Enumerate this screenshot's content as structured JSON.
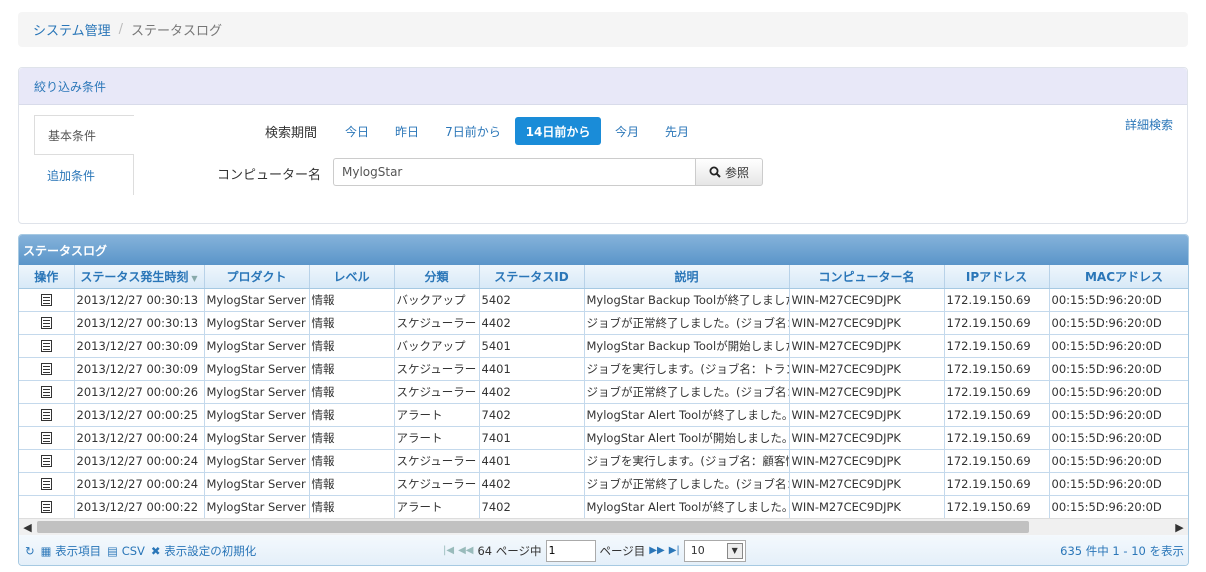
{
  "breadcrumb": {
    "parent": "システム管理",
    "separator": "/",
    "current": "ステータスログ"
  },
  "filter": {
    "header": "絞り込み条件",
    "tabs": [
      "基本条件",
      "追加条件"
    ],
    "period_label": "検索期間",
    "periods": [
      "今日",
      "昨日",
      "7日前から",
      "14日前から",
      "今月",
      "先月"
    ],
    "active_period": "14日前から",
    "detail_search": "詳細検索",
    "computer_label": "コンピューター名",
    "computer_value": "MylogStar",
    "search_button": "参照"
  },
  "grid": {
    "title": "ステータスログ",
    "columns": [
      "操作",
      "ステータス発生時刻",
      "プロダクト",
      "レベル",
      "分類",
      "ステータスID",
      "説明",
      "コンピューター名",
      "IPアドレス",
      "MACアドレス"
    ],
    "rows": [
      [
        "2013/12/27 00:30:13",
        "MylogStar Server",
        "情報",
        "バックアップ",
        "5402",
        "MylogStar Backup Toolが終了しました。",
        "WIN-M27CEC9DJPK",
        "172.19.150.69",
        "00:15:5D:96:20:0D"
      ],
      [
        "2013/12/27 00:30:13",
        "MylogStar Server",
        "情報",
        "スケジューラー",
        "4402",
        "ジョブが正常終了しました。(ジョブ名：",
        "WIN-M27CEC9DJPK",
        "172.19.150.69",
        "00:15:5D:96:20:0D"
      ],
      [
        "2013/12/27 00:30:09",
        "MylogStar Server",
        "情報",
        "バックアップ",
        "5401",
        "MylogStar Backup Toolが開始しました。",
        "WIN-M27CEC9DJPK",
        "172.19.150.69",
        "00:15:5D:96:20:0D"
      ],
      [
        "2013/12/27 00:30:09",
        "MylogStar Server",
        "情報",
        "スケジューラー",
        "4401",
        "ジョブを実行します。(ジョブ名：トラン",
        "WIN-M27CEC9DJPK",
        "172.19.150.69",
        "00:15:5D:96:20:0D"
      ],
      [
        "2013/12/27 00:00:26",
        "MylogStar Server",
        "情報",
        "スケジューラー",
        "4402",
        "ジョブが正常終了しました。(ジョブ名：",
        "WIN-M27CEC9DJPK",
        "172.19.150.69",
        "00:15:5D:96:20:0D"
      ],
      [
        "2013/12/27 00:00:25",
        "MylogStar Server",
        "情報",
        "アラート",
        "7402",
        "MylogStar Alert Toolが終了しました。",
        "WIN-M27CEC9DJPK",
        "172.19.150.69",
        "00:15:5D:96:20:0D"
      ],
      [
        "2013/12/27 00:00:24",
        "MylogStar Server",
        "情報",
        "アラート",
        "7401",
        "MylogStar Alert Toolが開始しました。",
        "WIN-M27CEC9DJPK",
        "172.19.150.69",
        "00:15:5D:96:20:0D"
      ],
      [
        "2013/12/27 00:00:24",
        "MylogStar Server",
        "情報",
        "スケジューラー",
        "4401",
        "ジョブを実行します。(ジョブ名：顧客情",
        "WIN-M27CEC9DJPK",
        "172.19.150.69",
        "00:15:5D:96:20:0D"
      ],
      [
        "2013/12/27 00:00:24",
        "MylogStar Server",
        "情報",
        "スケジューラー",
        "4402",
        "ジョブが正常終了しました。(ジョブ名：",
        "WIN-M27CEC9DJPK",
        "172.19.150.69",
        "00:15:5D:96:20:0D"
      ],
      [
        "2013/12/27 00:00:22",
        "MylogStar Server",
        "情報",
        "アラート",
        "7402",
        "MylogStar Alert Toolが終了しました。",
        "WIN-M27CEC9DJPK",
        "172.19.150.69",
        "00:15:5D:96:20:0D"
      ]
    ],
    "row_action_icon": "document-icon"
  },
  "pager": {
    "display_items": "表示項目",
    "csv": "CSV",
    "reset_settings": "表示設定の初期化",
    "total_pages_text": "64 ページ中",
    "current_page": "1",
    "page_suffix": "ページ目",
    "per_page": "10",
    "summary": "635 件中 1 - 10 を表示"
  },
  "colors": {
    "accent": "#1a8cd8",
    "link": "#2a76b8",
    "grid_header": "#5a95c9"
  }
}
